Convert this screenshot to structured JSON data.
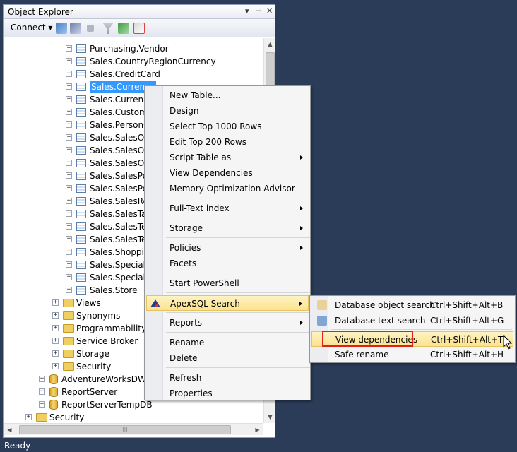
{
  "panel": {
    "title": "Object Explorer",
    "title_buttons": [
      "▾",
      "⊣",
      "✕"
    ],
    "connect_label": "Connect ▾"
  },
  "tree": {
    "tables": [
      "Purchasing.Vendor",
      "Sales.CountryRegionCurrency",
      "Sales.CreditCard",
      "Sales.Currency",
      "Sales.Currency",
      "Sales.Custome",
      "Sales.PersonCr",
      "Sales.SalesOrd",
      "Sales.SalesOrd",
      "Sales.SalesOrd",
      "Sales.SalesPers",
      "Sales.SalesPers",
      "Sales.SalesRea",
      "Sales.SalesTaxl",
      "Sales.SalesTerr",
      "Sales.SalesTerr",
      "Sales.Shopping",
      "Sales.SpecialO",
      "Sales.SpecialO",
      "Sales.Store"
    ],
    "db_folders": [
      "Views",
      "Synonyms",
      "Programmability",
      "Service Broker",
      "Storage",
      "Security"
    ],
    "databases": [
      "AdventureWorksDW2",
      "ReportServer",
      "ReportServerTempDB"
    ],
    "server_folders": [
      "Security"
    ],
    "selected_index": 3
  },
  "context_menu": {
    "groups": [
      [
        "New Table...",
        "Design",
        "Select Top 1000 Rows",
        "Edit Top 200 Rows",
        "Script Table as",
        "View Dependencies",
        "Memory Optimization Advisor"
      ],
      [
        "Full-Text index"
      ],
      [
        "Storage"
      ],
      [
        "Policies",
        "Facets"
      ],
      [
        "Start PowerShell"
      ],
      [
        "ApexSQL Search"
      ],
      [
        "Reports"
      ],
      [
        "Rename",
        "Delete"
      ],
      [
        "Refresh",
        "Properties"
      ]
    ]
  },
  "submenu": {
    "items": [
      {
        "label": "Database object search",
        "shortcut": "Ctrl+Shift+Alt+B"
      },
      {
        "label": "Database text search",
        "shortcut": "Ctrl+Shift+Alt+G"
      },
      {
        "label": "View dependencies",
        "shortcut": "Ctrl+Shift+Alt+T"
      },
      {
        "label": "Safe rename",
        "shortcut": "Ctrl+Shift+Alt+H"
      }
    ]
  },
  "status": {
    "text": "Ready"
  },
  "colors": {
    "background": "#2b3c59",
    "selection": "#3399ff",
    "highlight": "#fbe38e",
    "callout": "#e02020"
  }
}
